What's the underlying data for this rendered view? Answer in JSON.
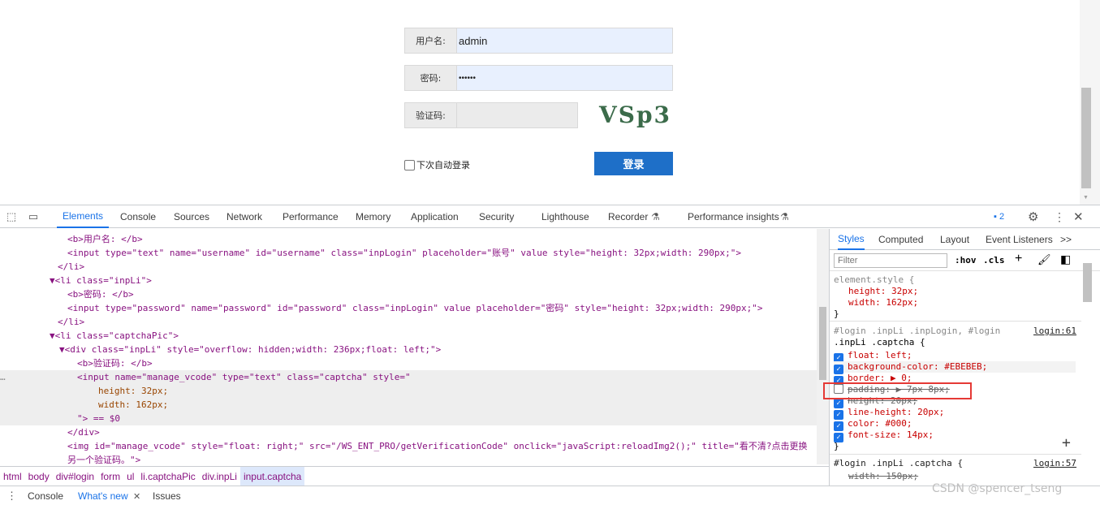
{
  "form": {
    "username_label": "用户名:",
    "username_value": "admin",
    "password_label": "密码:",
    "password_value": "••••••",
    "captcha_label": "验证码:",
    "captcha_text": "VSp3",
    "remember_label": "下次自动登录",
    "login_button": "登录"
  },
  "devtools": {
    "tabs": [
      "Elements",
      "Console",
      "Sources",
      "Network",
      "Performance",
      "Memory",
      "Application",
      "Security",
      "Lighthouse",
      "Recorder",
      "Performance insights"
    ],
    "issues_count": "2",
    "code_lines": [
      {
        "t": "<b>用户名: </b>"
      },
      {
        "t": "<input type=\"text\" name=\"username\" id=\"username\" class=\"inpLogin\" placeholder=\"账号\" value style=\"height: 32px;width: 290px;\">"
      },
      {
        "t": "</li>"
      },
      {
        "t": "▼<li class=\"inpLi\">"
      },
      {
        "t": "<b>密码: </b>"
      },
      {
        "t": "<input type=\"password\" name=\"password\" id=\"password\" class=\"inpLogin\" value placeholder=\"密码\" style=\"height: 32px;width: 290px;\">"
      },
      {
        "t": "</li>"
      },
      {
        "t": "▼<li class=\"captchaPic\">"
      },
      {
        "t": "▼<div class=\"inpLi\" style=\"overflow: hidden;width: 236px;float: left;\">"
      },
      {
        "t": "<b>验证码: </b>"
      },
      {
        "t": "<input name=\"manage_vcode\" type=\"text\" class=\"captcha\" style=\""
      },
      {
        "t": "height: 32px;"
      },
      {
        "t": "width: 162px;"
      },
      {
        "t": "\"> == $0"
      },
      {
        "t": "</div>"
      },
      {
        "t": "<img id=\"manage_vcode\" style=\"float: right;\" src=\"/WS_ENT_PRO/getVerificationCode\" onclick=\"javaScript:reloadImg2();\" title=\"看不清?点击更换"
      },
      {
        "t": "另一个验证码。\">"
      }
    ],
    "crumbs": [
      "html",
      "body",
      "div#login",
      "form",
      "ul",
      "li.captchaPic",
      "div.inpLi",
      "input.captcha"
    ],
    "styles_tabs": [
      "Styles",
      "Computed",
      "Layout",
      "Event Listeners",
      ">>"
    ],
    "filter_placeholder": "Filter",
    "hov": ":hov",
    "cls": ".cls",
    "rules": [
      {
        "text": "element.style {"
      },
      {
        "text": "height: 32px;"
      },
      {
        "text": "width: 162px;"
      },
      {
        "text": "}"
      },
      {
        "text": "#login .inpLi .inpLogin, #login"
      },
      {
        "text": ".inpLi .captcha {"
      },
      {
        "text": "login:61"
      },
      {
        "text": "float: left;"
      },
      {
        "text": "background-color: #EBEBEB;"
      },
      {
        "text": "border: ▶ 0;"
      },
      {
        "text": "padding: ▶ 7px 8px;"
      },
      {
        "text": "height: 20px;"
      },
      {
        "text": "line-height: 20px;"
      },
      {
        "text": "color: #000;"
      },
      {
        "text": "font-size: 14px;"
      },
      {
        "text": "}"
      },
      {
        "text": "#login .inpLi .captcha {"
      },
      {
        "text": "login:57"
      },
      {
        "text": "width: 150px;"
      }
    ],
    "drawer": [
      "Console",
      "What's new",
      "Issues"
    ]
  },
  "watermark": "CSDN @spencer_tseng"
}
